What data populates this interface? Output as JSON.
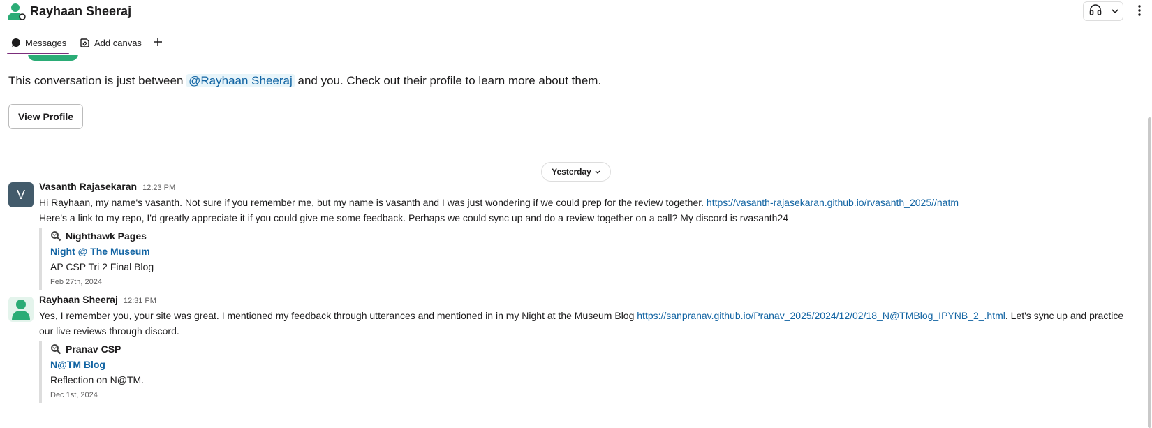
{
  "header": {
    "title": "Rayhaan Sheeraj",
    "avatar_icon": "user-presence-icon",
    "huddle_icon": "headphones-icon",
    "huddle_caret_icon": "chevron-down-icon",
    "more_icon": "kebab-menu-icon"
  },
  "tabs": [
    {
      "label": "Messages",
      "icon": "message-bubble-icon",
      "active": true
    },
    {
      "label": "Add canvas",
      "icon": "canvas-icon"
    },
    {
      "label": "+",
      "icon": "plus-icon"
    }
  ],
  "intro": {
    "before": "This conversation is just between ",
    "mention": "@Rayhaan Sheeraj",
    "after": " and you. Check out their profile to learn more about them.",
    "view_profile_label": "View Profile"
  },
  "date_divider": {
    "label": "Yesterday",
    "caret": "⌄"
  },
  "messages": [
    {
      "sender": "Vasanth Rajasekaran",
      "time": "12:23 PM",
      "avatar_letter": "V",
      "line1": "Hi Rayhaan, my name's vasanth. Not sure if you remember me, but my name is vasanth and I was just wondering if we could prep for the review together. ",
      "link": "https://vasanth-rajasekaran.github.io/rvasanth_2025//natm",
      "line2": "Here's a link to my repo, I'd greatly appreciate it if you could give me some feedback. Perhaps we could sync up and do a review together on a call? My discord is rvasanth24",
      "unfurl": {
        "site": "Nighthawk Pages",
        "title": "Night @ The Museum",
        "description": "AP CSP Tri 2 Final Blog",
        "date": "Feb 27th, 2024"
      }
    },
    {
      "sender": "Rayhaan Sheeraj",
      "time": "12:31 PM",
      "text_before": "Yes, I remember you, your site was great. I mentioned my feedback through utterances and mentioned in in my Night at the Museum Blog ",
      "link": "https://sanpranav.github.io/Pranav_2025/2024/12/02/18_N@TMBlog_IPYNB_2_.html",
      "text_after": ". Let's sync up and practice our live reviews through discord.",
      "unfurl": {
        "site": "Pranav CSP",
        "title": "N@TM Blog",
        "description": "Reflection on N@TM.",
        "date": "Dec 1st, 2024"
      }
    }
  ],
  "colors": {
    "accent": "#7b2d7b",
    "link": "#1264a3",
    "presence_green": "#2bac76",
    "avatar_slate": "#435b6b"
  }
}
